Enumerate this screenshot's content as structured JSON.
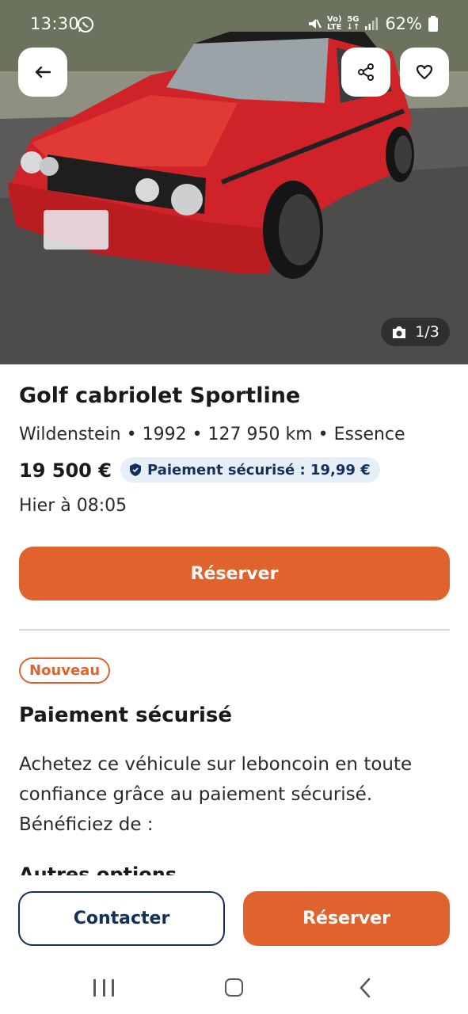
{
  "status_bar": {
    "time": "13:30",
    "battery": "62%",
    "whatsapp_icon": "whatsapp-icon",
    "net1_top": "Vo)",
    "net1_bottom": "LTE",
    "net2_top": "5G",
    "net2_bottom": "↓↑"
  },
  "hero": {
    "photo_counter": "1/3",
    "camera_icon": "camera-icon",
    "back_icon": "arrow-left-icon",
    "share_icon": "share-icon",
    "favorite_icon": "heart-icon"
  },
  "listing": {
    "title": "Golf cabriolet Sportline",
    "meta": "Wildenstein • 1992 • 127 950 km • Essence",
    "price": "19 500 €",
    "secure_payment_badge": "Paiement sécurisé : 19,99 €",
    "date": "Hier à 08:05",
    "reserve_label": "Réserver"
  },
  "secure_section": {
    "new_tag": "Nouveau",
    "title": "Paiement sécurisé",
    "body": "Achetez ce véhicule sur leboncoin en toute confiance grâce au paiement sécurisé. Bénéficiez de :",
    "peek": "Autres options"
  },
  "bottom_bar": {
    "contact_label": "Contacter",
    "reserve_label": "Réserver"
  },
  "colors": {
    "accent": "#e0622c",
    "navy": "#14305a",
    "badge_bg": "#e6eef8",
    "car_red": "#d8262c"
  }
}
